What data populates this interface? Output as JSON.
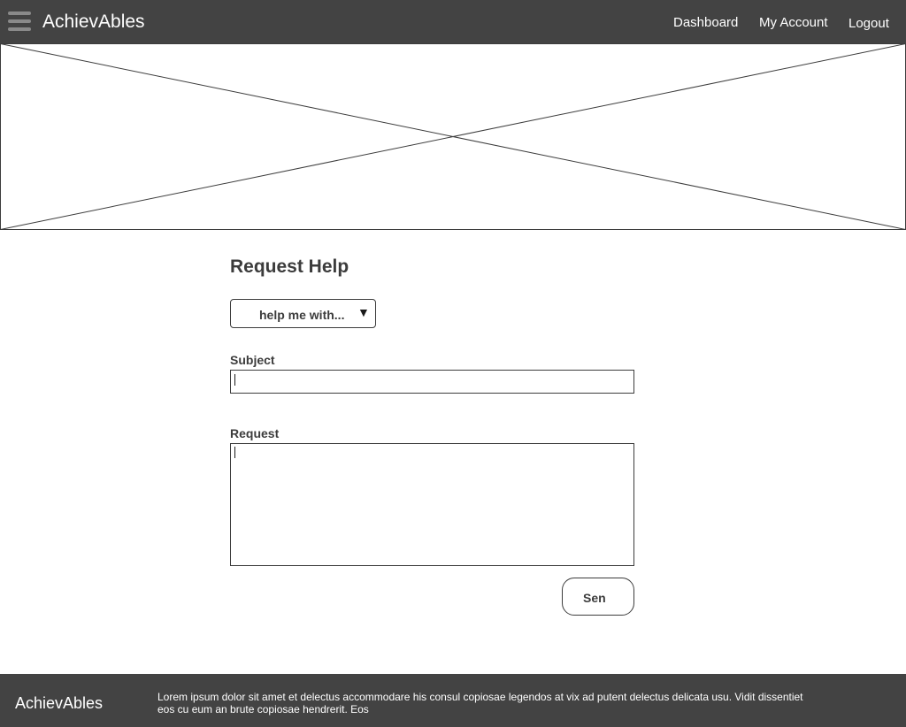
{
  "header": {
    "app_title": "AchievAbles",
    "nav": {
      "dashboard": "Dashboard",
      "my_account": "My Account",
      "logout": "Logout"
    },
    "menu_icon": "hamburger-icon"
  },
  "hero": {
    "icon": "image-placeholder-icon"
  },
  "form": {
    "title": "Request Help",
    "category_select": {
      "selected": "help me with...",
      "arrow": "▼"
    },
    "subject": {
      "label": "Subject",
      "value": ""
    },
    "request": {
      "label": "Request",
      "value": ""
    },
    "send_label": "Sen"
  },
  "footer": {
    "brand": "AchievAbles",
    "text": "Lorem ipsum dolor sit amet et delectus accommodare his consul copiosae legendos at vix ad putent delectus delicata usu. Vidit dissentiet eos cu eum an brute copiosae hendrerit. Eos"
  },
  "colors": {
    "header_bg": "#434343",
    "footer_bg": "#434343",
    "text": "#3c3c3c",
    "header_text": "#ffffff"
  }
}
